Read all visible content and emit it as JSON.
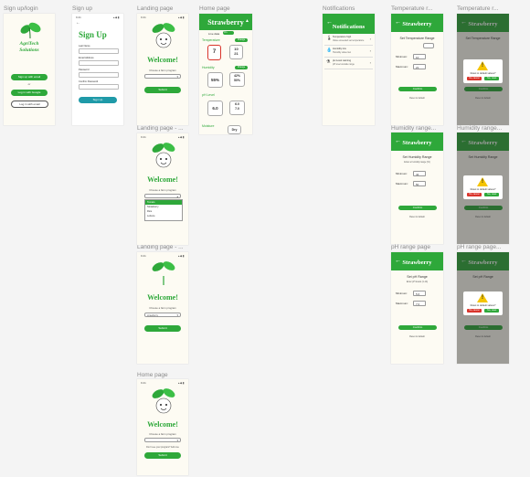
{
  "labels": {
    "signup_login": "Sign up/login",
    "signup": "Sign up",
    "landing1": "Landing page",
    "home1": "Home page",
    "notifications": "Notifications",
    "temp1": "Temperature r...",
    "temp2": "Temperature r...",
    "landing2": "Landing page - ...",
    "humid1": "Humidity range...",
    "humid2": "Humidity range...",
    "landing3": "Landing page - ...",
    "ph1": "pH range page",
    "ph2": "pH range page...",
    "home2": "Home page"
  },
  "status": {
    "time": "9:41",
    "icons": "▴◆▮"
  },
  "splash": {
    "brand": "AgriTech",
    "brand2": "Solutions",
    "signup_btn": "Sign up with email",
    "or": "or",
    "google_btn": "Log in with Google",
    "email_btn": "Log in with email"
  },
  "signup": {
    "title": "Sign Up",
    "f1": "Last Name",
    "f2": "Email Address",
    "f3": "Password",
    "f4": "Confirm Password",
    "submit": "Sign Up"
  },
  "landing": {
    "welcome": "Welcome!",
    "choose": "Choose a farm program",
    "select_placeholder": "",
    "opt1": "Tomato",
    "opt2": "Strawberry",
    "opt3": "Rice",
    "opt4": "Lettuce",
    "selected": "strawberry",
    "submit": "Submit",
    "note": "Don't see your program? Add one"
  },
  "home": {
    "title": "Strawberry",
    "live": "Live data",
    "toggle": "On",
    "temp_label": "Temperature",
    "temp_val": "7",
    "temp_min": "10",
    "temp_max": "21",
    "humid_label": "Humidity",
    "humid_val": "55%",
    "humid_min": "42%",
    "humid_max": "50%",
    "ph_label": "pH Level",
    "ph_val": "6.0",
    "ph_min": "6.0",
    "ph_max": "7.0",
    "water_label": "Moisture",
    "water_val": "Dry",
    "change": "Change"
  },
  "notifications": {
    "title": "Notifications",
    "items": [
      {
        "icon": "🌡",
        "t1": "Temperature high",
        "t2": "Value exceeded set temperature"
      },
      {
        "icon": "💧",
        "t1": "Humidity low",
        "t2": "Humidity value low"
      },
      {
        "icon": "⚗",
        "t1": "pH Level warning",
        "t2": "pH level outside range"
      }
    ]
  },
  "temp": {
    "title": "Strawberry",
    "heading": "Set Temperature Range",
    "min_label": "Minimum:",
    "max_label": "Maximum:",
    "min_val": "10",
    "max_val": "21",
    "confirm": "Confirm",
    "reset": "Reset to default"
  },
  "humid": {
    "title": "Strawberry",
    "heading": "Set Humidity Range",
    "sub": "Enter a humidity range (%)",
    "min_label": "Minimum:",
    "max_label": "Maximum:",
    "min_val": "42",
    "max_val": "50",
    "confirm": "Confirm",
    "reset": "Reset to default"
  },
  "ph": {
    "title": "Strawberry",
    "heading": "Set pH Range",
    "sub": "Enter pH levels (1-14)",
    "min_label": "Minimum:",
    "max_label": "Maximum:",
    "min_val": "5.6",
    "max_val": "7.0",
    "confirm": "Confirm",
    "reset": "Reset to default"
  },
  "dialog": {
    "question": "Reset to default values?",
    "no": "No, cancel",
    "yes": "Yes, reset"
  },
  "colors": {
    "green": "#2ea83a",
    "red": "#d9342b",
    "warn": "#f5c400"
  }
}
